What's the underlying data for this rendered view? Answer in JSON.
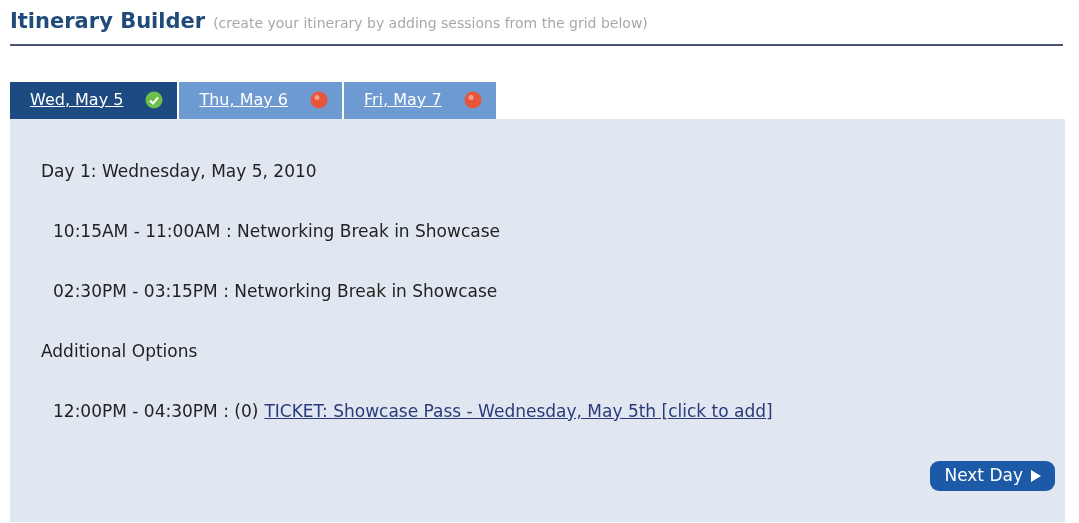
{
  "header": {
    "title": "Itinerary Builder",
    "subtitle": "(create your itinerary by adding sessions from the grid below)"
  },
  "tabs": [
    {
      "label": "Wed, May 5",
      "selected": true,
      "complete": true
    },
    {
      "label": "Thu, May 6",
      "selected": false,
      "complete": false
    },
    {
      "label": "Fri, May 7",
      "selected": false,
      "complete": false
    }
  ],
  "day_heading": "Day 1: Wednesday, May 5, 2010",
  "sessions": [
    {
      "time": "10:15AM - 11:00AM :",
      "title": "Networking Break in Showcase"
    },
    {
      "time": "02:30PM - 03:15PM :",
      "title": "Networking Break in Showcase"
    }
  ],
  "additional_heading": "Additional Options",
  "options": [
    {
      "time": "12:00PM - 04:30PM : (0)",
      "link": "TICKET: Showcase Pass - Wednesday, May 5th [click to add]"
    }
  ],
  "next_button": "Next Day"
}
